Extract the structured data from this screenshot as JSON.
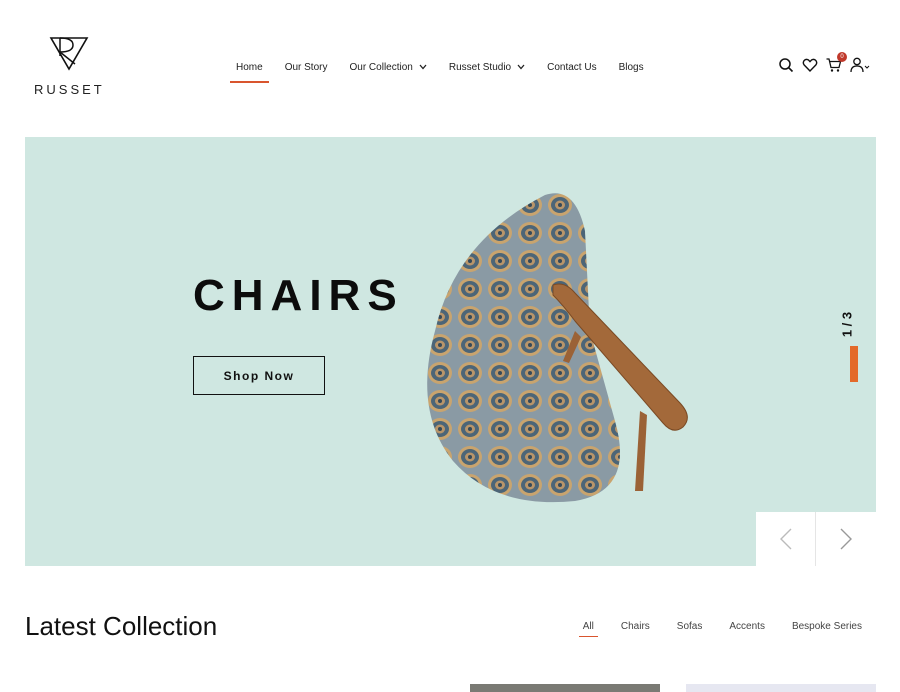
{
  "brand": {
    "name": "RUSSET"
  },
  "nav": {
    "items": [
      {
        "label": "Home",
        "active": true,
        "dropdown": false
      },
      {
        "label": "Our Story",
        "active": false,
        "dropdown": false
      },
      {
        "label": "Our Collection",
        "active": false,
        "dropdown": true
      },
      {
        "label": "Russet Studio",
        "active": false,
        "dropdown": true
      },
      {
        "label": "Contact Us",
        "active": false,
        "dropdown": false
      },
      {
        "label": "Blogs",
        "active": false,
        "dropdown": false
      }
    ]
  },
  "header_icons": {
    "search": "search-icon",
    "wishlist": "heart-icon",
    "cart": "cart-icon",
    "cart_count": "0",
    "account": "user-icon"
  },
  "hero": {
    "title": "CHAIRS",
    "button_label": "Shop Now",
    "slide_counter": "1 / 3",
    "background_color": "#cfe7e1",
    "accent_color": "#e36a2a"
  },
  "latest": {
    "title": "Latest Collection",
    "filters": [
      "All",
      "Chairs",
      "Sofas",
      "Accents",
      "Bespoke Series"
    ]
  },
  "colors": {
    "accent": "#d9552e"
  }
}
